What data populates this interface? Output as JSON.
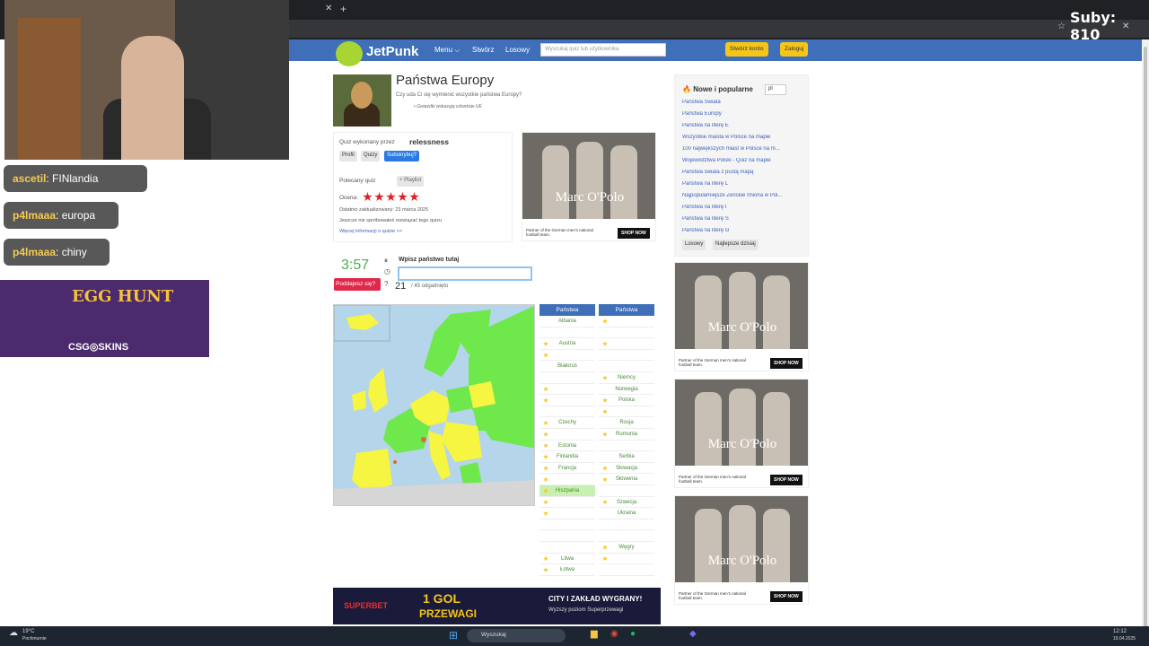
{
  "overlay": {
    "subs": "Suby: 810",
    "chat": [
      {
        "user": "ascetil",
        "message": ": FINlandia"
      },
      {
        "user": "p4lmaaa",
        "message": ": europa"
      },
      {
        "user": "p4lmaaa",
        "message": ": chiny"
      }
    ],
    "promo": {
      "title": "EGG HUNT",
      "brand": "CSG◎SKINS"
    }
  },
  "header": {
    "logo": "JetPunk",
    "nav": [
      "Menu ⌵",
      "Stwórz",
      "Losowy"
    ],
    "search_placeholder": "Wyszukaj quiz lub użytkownika",
    "create_account": "Stwórz konto",
    "login": "Zaloguj"
  },
  "quiz": {
    "title": "Państwa Europy",
    "description": "Czy uda Ci się wymienić wszystkie państwa Europy?",
    "note": "Gwiazdki wskazują członków UE",
    "made_by_label": "Quiz wykonany przez",
    "author": "relessness",
    "profile": "Profil",
    "quizzes": "Quizy",
    "subscribe": "Subskrybuj?",
    "recommended": "Polecany quiz",
    "playlist": "+ Playlist",
    "rating_label": "Ocena:",
    "rating": 5,
    "updated": "Ostatnio zaktualizowany: 23 marca 2025",
    "not_tried": "Jeszcze nie spróbowałeś rozwiązać tego quizu",
    "more_info": "Więcej informacji o quizie >>"
  },
  "game": {
    "timer": "3:57",
    "give_up": "Poddajesz się?",
    "prompt": "Wpisz państwo tutaj",
    "answer": "",
    "score": "21",
    "score_total": "/ 45 odgadnięto"
  },
  "table": {
    "header": "Państwa",
    "col1": [
      {
        "name": "Albania",
        "star": false
      },
      {
        "name": "",
        "star": false
      },
      {
        "name": "Austria",
        "star": true
      },
      {
        "name": "",
        "star": true
      },
      {
        "name": "Białoruś",
        "star": false
      },
      {
        "name": "",
        "star": false
      },
      {
        "name": "",
        "star": true
      },
      {
        "name": "",
        "star": true
      },
      {
        "name": "",
        "star": false
      },
      {
        "name": "Czechy",
        "star": true
      },
      {
        "name": "",
        "star": true
      },
      {
        "name": "Estonia",
        "star": true
      },
      {
        "name": "Finlandia",
        "star": true
      },
      {
        "name": "Francja",
        "star": true
      },
      {
        "name": "",
        "star": true
      },
      {
        "name": "Hiszpania",
        "star": true
      },
      {
        "name": "",
        "star": true
      },
      {
        "name": "",
        "star": true
      },
      {
        "name": "",
        "star": false
      },
      {
        "name": "",
        "star": false
      },
      {
        "name": "",
        "star": false
      },
      {
        "name": "Litwa",
        "star": true
      },
      {
        "name": "Łotwa",
        "star": true
      }
    ],
    "col2": [
      {
        "name": "",
        "star": true
      },
      {
        "name": "",
        "star": false
      },
      {
        "name": "",
        "star": true
      },
      {
        "name": "",
        "star": false
      },
      {
        "name": "",
        "star": false
      },
      {
        "name": "Niemcy",
        "star": true
      },
      {
        "name": "Norwegia",
        "star": false
      },
      {
        "name": "Polska",
        "star": true
      },
      {
        "name": "",
        "star": true
      },
      {
        "name": "Rosja",
        "star": false
      },
      {
        "name": "Rumunia",
        "star": true
      },
      {
        "name": "",
        "star": false
      },
      {
        "name": "Serbia",
        "star": false
      },
      {
        "name": "Słowacja",
        "star": true
      },
      {
        "name": "Słowenia",
        "star": true
      },
      {
        "name": "",
        "star": false
      },
      {
        "name": "Szwecja",
        "star": true
      },
      {
        "name": "Ukraina",
        "star": false
      },
      {
        "name": "",
        "star": false
      },
      {
        "name": "",
        "star": false
      },
      {
        "name": "Węgry",
        "star": true
      },
      {
        "name": "",
        "star": true
      },
      {
        "name": "",
        "star": false
      }
    ]
  },
  "sidebar": {
    "title": "Nowe i popularne",
    "lang": "pl",
    "items": [
      "Państwa Świata",
      "Państwa Europy",
      "Państwa na literę E",
      "Wszystkie miasta w Polsce na mapie",
      "100 największych miast w Polsce na m...",
      "Województwa Polski - Quiz na mapie",
      "Państwa świata z pustą mapą",
      "Państwa na literę L",
      "Najpopularniejsze Żeńskie Imiona w Pol...",
      "Państwa na literę I",
      "Państwa na literę S",
      "Państwa na literę G"
    ],
    "random": "Losowy",
    "best_today": "Najlepsze dzisiaj"
  },
  "ads": {
    "brand": "Marc O'Polo",
    "caption": "Partner of the German men's national football team.",
    "shop": "SHOP NOW"
  },
  "banner": {
    "left": "SUPERBET",
    "center_top": "1 GOL",
    "center": "PRZEWAGI",
    "right": "CITY I ZAKŁAD WYGRANY!",
    "right2": "Wyższy poziom Superprzewagi"
  },
  "taskbar": {
    "weather": "19°C",
    "weather2": "Pochmurnie",
    "search": "Wyszukaj",
    "time": "12:12",
    "date": "19.04.2025"
  }
}
